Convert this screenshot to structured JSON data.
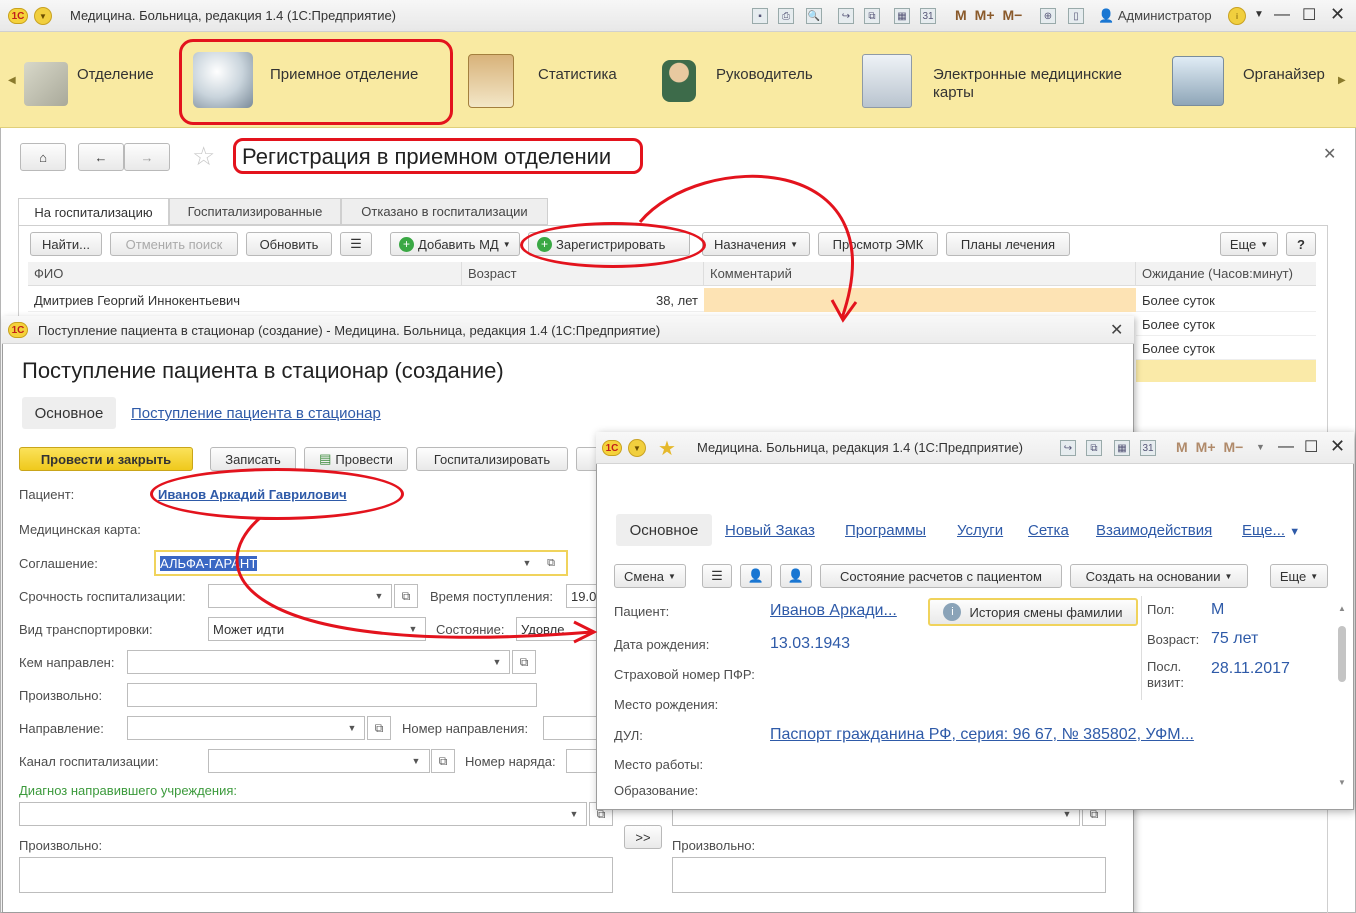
{
  "main_window": {
    "title": "Медицина. Больница, редакция 1.4  (1С:Предприятие)",
    "user": "Администратор",
    "mem_buttons": [
      "M",
      "M+",
      "M−"
    ]
  },
  "sections": [
    {
      "label": "Отделение"
    },
    {
      "label": "Приемное отделение"
    },
    {
      "label": "Статистика"
    },
    {
      "label": "Руководитель"
    },
    {
      "label": "Электронные медицинские карты"
    },
    {
      "label": "Органайзер"
    }
  ],
  "page": {
    "title": "Регистрация в приемном отделении",
    "tabs": [
      "На госпитализацию",
      "Госпитализированные",
      "Отказано в госпитализации"
    ],
    "toolbar": {
      "find": "Найти...",
      "cancel_search": "Отменить поиск",
      "refresh": "Обновить",
      "add_md": "Добавить МД",
      "register": "Зарегистрировать",
      "assignments": "Назначения",
      "view_emk": "Просмотр ЭМК",
      "treatment_plans": "Планы лечения",
      "more": "Еще",
      "help": "?"
    },
    "columns": {
      "name": "ФИО",
      "age": "Возраст",
      "comment": "Комментарий",
      "waiting": "Ожидание (Часов:минут)"
    },
    "rows": [
      {
        "name": "Дмитриев Георгий Иннокентьевич",
        "age": "38, лет",
        "comment": "",
        "waiting": "Более суток"
      },
      {
        "name": "",
        "age": "",
        "comment": "",
        "waiting": "Более суток"
      },
      {
        "name": "",
        "age": "",
        "comment": "",
        "waiting": "Более суток"
      },
      {
        "name": "",
        "age": "",
        "comment": "",
        "waiting": ""
      }
    ]
  },
  "admission_window": {
    "window_title": "Поступление пациента в стационар (создание) - Медицина. Больница, редакция 1.4  (1С:Предприятие)",
    "heading": "Поступление пациента в стационар (создание)",
    "nav_main": "Основное",
    "nav_link": "Поступление пациента в стационар",
    "buttons": {
      "post_close": "Провести и закрыть",
      "save": "Записать",
      "post": "Провести",
      "hospitalize": "Госпитализировать",
      "arrow": ">>"
    },
    "labels": {
      "patient": "Пациент:",
      "med_card": "Медицинская карта:",
      "agreement": "Соглашение:",
      "urgency": "Срочность госпитализации:",
      "arrival_time": "Время поступления:",
      "transport": "Вид транспортировки:",
      "state": "Состояние:",
      "referred_by": "Кем направлен:",
      "free1": "Произвольно:",
      "referral": "Направление:",
      "referral_number": "Номер направления:",
      "channel": "Канал госпитализации:",
      "order_number": "Номер наряда:",
      "diagnosis": "Диагноз направившего учреждения:",
      "free2": "Произвольно:",
      "free3": "Произвольно:"
    },
    "values": {
      "patient": "Иванов Аркадий Гаврилович",
      "agreement": "АЛЬФА-ГАРАНТ",
      "arrival_time": "19.0",
      "transport": "Может идти",
      "state": "Удовле"
    }
  },
  "patient_window": {
    "title": "Медицина. Больница, редакция 1.4  (1С:Предприятие)",
    "mem_buttons": [
      "M",
      "M+",
      "M−"
    ],
    "tabs": [
      "Основное",
      "Новый Заказ",
      "Программы",
      "Услуги",
      "Сетка",
      "Взаимодействия",
      "Еще..."
    ],
    "toolbar": {
      "change": "Смена",
      "settlement": "Состояние расчетов с пациентом",
      "create_based": "Создать на основании",
      "more": "Еще"
    },
    "fields": {
      "patient_label": "Пациент:",
      "patient_value": "Иванов Аркади...",
      "history_button": "История смены фамилии",
      "birth_label": "Дата рождения:",
      "birth_value": "13.03.1943",
      "snils_label": "Страховой номер ПФР:",
      "birthplace_label": "Место рождения:",
      "doc_label": "ДУЛ:",
      "doc_value": "Паспорт гражданина РФ, серия: 96 67, № 385802, УФМ...",
      "work_label": "Место работы:",
      "education_label": "Образование:",
      "sex_label": "Пол:",
      "sex_value": "М",
      "age_label": "Возраст:",
      "age_value": "75 лет",
      "last_visit_label": "Посл. визит:",
      "last_visit_value": "28.11.2017"
    }
  },
  "colors": {
    "section_bar": "#f9eaa2",
    "primary_button": "#f4d22e",
    "link": "#2e5aa8",
    "highlight_row": "#fde3b4",
    "annotation": "#e3131d"
  }
}
